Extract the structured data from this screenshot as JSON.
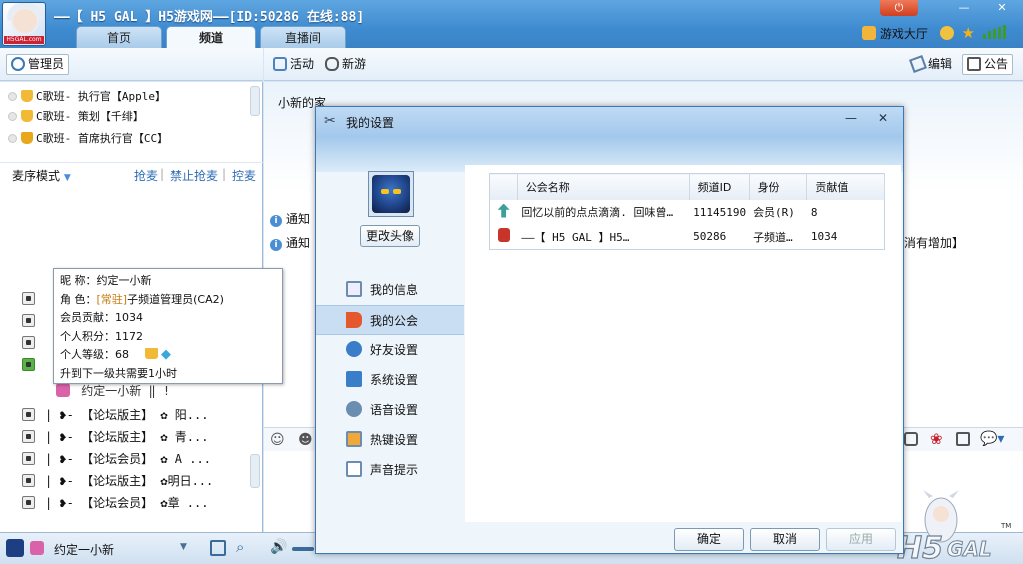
{
  "window": {
    "title": "——【 H5 GAL 】H5游戏网——[ID:50286 在线:88]",
    "tabs": [
      {
        "label": "首页"
      },
      {
        "label": "频道"
      },
      {
        "label": "直播间"
      }
    ],
    "top_right_link": "游戏大厅"
  },
  "toolbar_left": {
    "admin_label": "管理员"
  },
  "toolbar_right": {
    "activity_label": "活动",
    "newgame_label": "新游",
    "edit_label": "编辑",
    "announce_label": "公告"
  },
  "admins": [
    {
      "label": "C歌班- 执行官【Apple】"
    },
    {
      "label": "C歌班- 策划【千绯】"
    },
    {
      "label": "C歌班- 首席执行官【CC】"
    }
  ],
  "seq_bar": {
    "mode": "麦序模式",
    "grab": "抢麦",
    "no_grab": "禁止抢麦",
    "control": "控麦"
  },
  "members": [
    {
      "label": "|  ❥-  【论坛版主】 ✿ 阳..."
    },
    {
      "label": "|  ❥-  【论坛版主】 ✿  青..."
    },
    {
      "label": "|  ❥-  【论坛会员】 ✿ A  ..."
    },
    {
      "label": "|  ❥-  【论坛版主】 ✿明日..."
    },
    {
      "label": "|  ❥-  【论坛会员】 ✿章  ..."
    }
  ],
  "current_member": {
    "name": "约定一小新",
    "extra": "约定一小新  ‖ !"
  },
  "tooltip": {
    "nick_label": "昵    称：",
    "nick": "约定一小新",
    "role_label": "角    色：",
    "role_tag": "[常驻]",
    "role": "子频道管理员(CA2)",
    "contrib": "会员贡献：1034",
    "points": "个人积分：1172",
    "level": "个人等级：68",
    "next": "升到下一级共需要1小时"
  },
  "main": {
    "banner_text": "小新的家",
    "notice1": "通知",
    "notice2": "通知",
    "notice2_tail": "消有增加】"
  },
  "statusbar": {
    "user": "约定一小新"
  },
  "dialog": {
    "title": "我的设置",
    "change_avatar": "更改头像",
    "nav": [
      {
        "label": "我的信息"
      },
      {
        "label": "我的公会"
      },
      {
        "label": "好友设置"
      },
      {
        "label": "系统设置"
      },
      {
        "label": "语音设置"
      },
      {
        "label": "热键设置"
      },
      {
        "label": "声音提示"
      }
    ],
    "table": {
      "headers": [
        "公会名称",
        "频道ID",
        "身份",
        "贡献值"
      ],
      "rows": [
        {
          "name": "回忆以前的点点滴滴. 回味曾…",
          "id": "11145190",
          "role": "会员(R)",
          "contrib": "8"
        },
        {
          "name": "——【 H5 GAL 】H5…",
          "id": "50286",
          "role": "子频道…",
          "contrib": "1034"
        }
      ]
    },
    "ok": "确定",
    "cancel": "取消",
    "apply": "应用"
  },
  "colors": {
    "titlebar": "#3f8bd0",
    "accent": "#2f6db3",
    "selected_nav": "#c9def3"
  }
}
